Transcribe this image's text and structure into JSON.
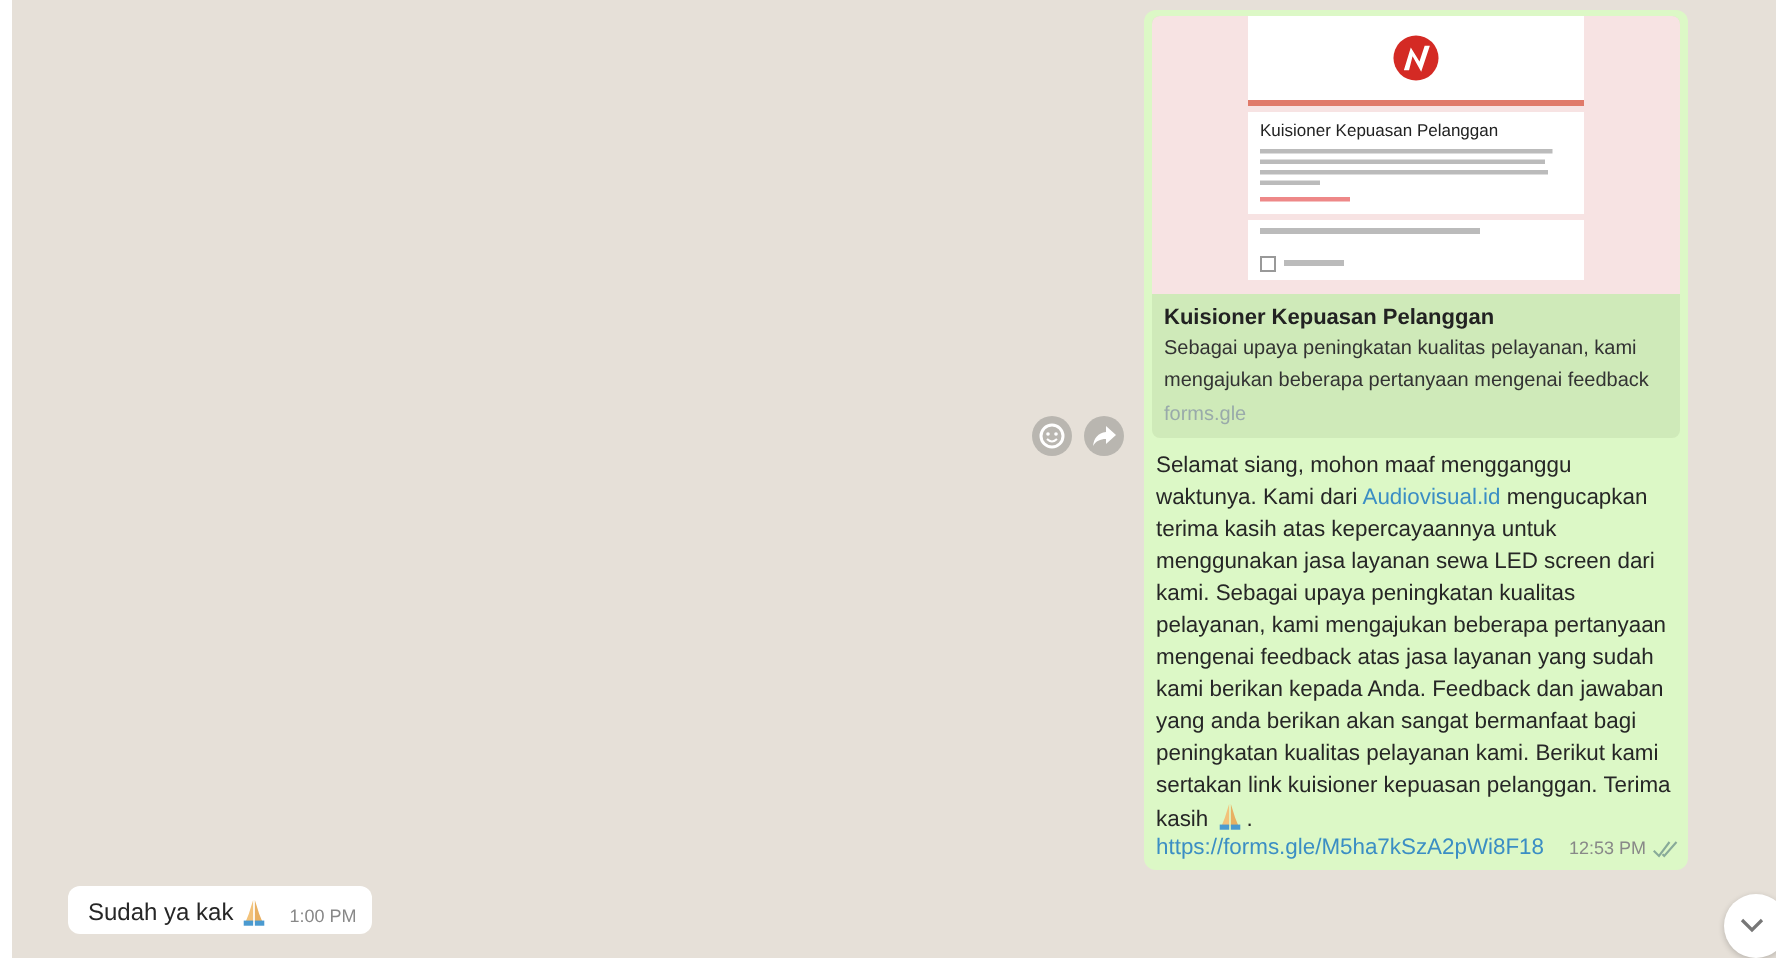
{
  "outgoing": {
    "preview": {
      "form_title": "Kuisioner Kepuasan Pelanggan",
      "title": "Kuisioner Kepuasan Pelanggan",
      "description": "Sebagai upaya peningkatan kualitas pelayanan, kami mengajukan beberapa pertanyaan mengenai feedback",
      "domain": "forms.gle"
    },
    "message": [
      {
        "kind": "text",
        "text": "Selamat siang, mohon maaf mengganggu waktunya. Kami dari "
      },
      {
        "kind": "link",
        "text": "Audiovisual.id"
      },
      {
        "kind": "text",
        "text": " mengucapkan terima kasih atas kepercayaannya untuk menggunakan jasa layanan sewa LED screen dari kami. Sebagai upaya peningkatan kualitas pelayanan, kami mengajukan beberapa pertanyaan mengenai feedback atas jasa layanan yang sudah kami berikan kepada Anda. Feedback dan jawaban yang anda berikan akan sangat bermanfaat bagi peningkatan kualitas pelayanan kami. Berikut kami sertakan link kuisioner kepuasan pelanggan. Terima kasih "
      },
      {
        "kind": "emoji"
      },
      {
        "kind": "text",
        "text": "."
      }
    ],
    "url": "https://forms.gle/M5ha7kSzA2pWi8F18",
    "time": "12:53 PM",
    "read": true
  },
  "incoming": {
    "text": "Sudah ya kak",
    "emoji": true,
    "time": "1:00 PM"
  }
}
